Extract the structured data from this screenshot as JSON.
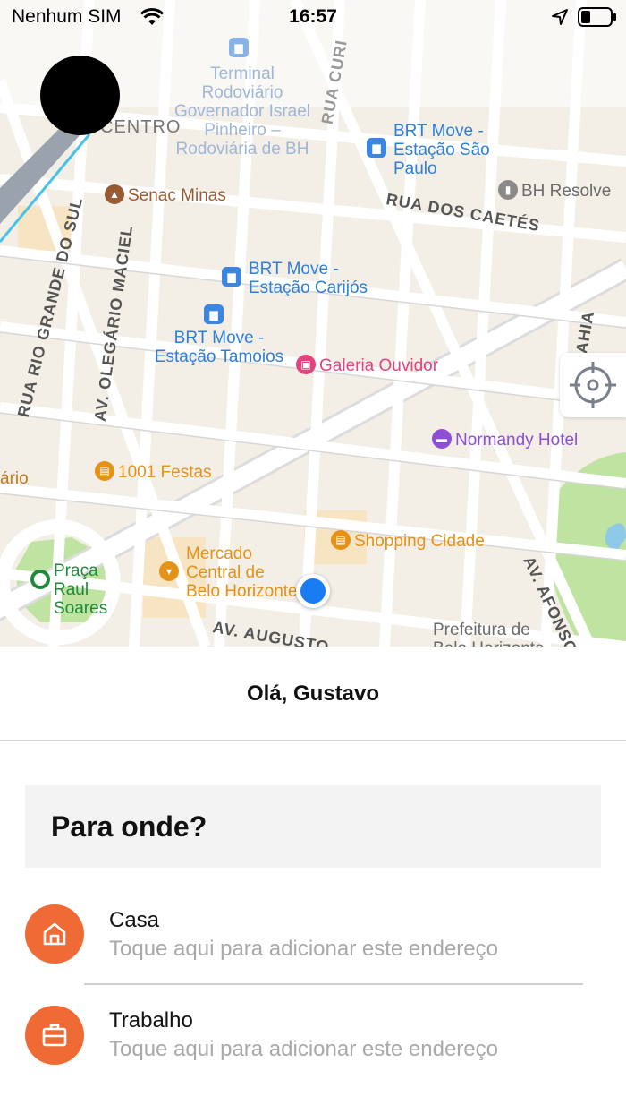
{
  "status_bar": {
    "carrier": "Nenhum SIM",
    "time": "16:57"
  },
  "map": {
    "district_label": "CENTRO",
    "streets": [
      "RUA DOS CAETÉS",
      "RUA RIO GRANDE DO SUL",
      "AV. OLEGÁRIO MACIEL",
      "AV. AFONSO P",
      "AV. AUGUSTO",
      "RUA CURI",
      "BAHIA"
    ],
    "pois": {
      "terminal": "Terminal Rodoviário Governador Israel Pinheiro – Rodoviária de BH",
      "brt_sao_paulo": "BRT Move - Estação São Paulo",
      "senac": "Senac Minas",
      "bh_resolve": "BH Resolve",
      "brt_carijos": "BRT Move - Estação Carijós",
      "brt_tamoios": "BRT Move - Estação Tamoios",
      "galeria": "Galeria Ouvidor",
      "normandy": "Normandy Hotel",
      "festas": "1001 Festas",
      "shopping": "Shopping Cidade",
      "mercado": "Mercado Central de Belo Horizonte",
      "praca": "Praça Raul Soares",
      "prefeitura": "Prefeitura de Belo Horizonte",
      "cut_left": "ário"
    },
    "colors": {
      "background": "#f3efe6",
      "road": "#ffffff",
      "park": "#bfe3a0",
      "user_location": "#1a7cf5"
    }
  },
  "sheet": {
    "greeting": "Olá, Gustavo",
    "destination_prompt": "Para onde?",
    "places": [
      {
        "title": "Casa",
        "subtitle": "Toque aqui para adicionar este endereço",
        "icon": "home-icon"
      },
      {
        "title": "Trabalho",
        "subtitle": "Toque aqui para adicionar este endereço",
        "icon": "briefcase-icon"
      }
    ],
    "accent_color": "#f06a35"
  }
}
